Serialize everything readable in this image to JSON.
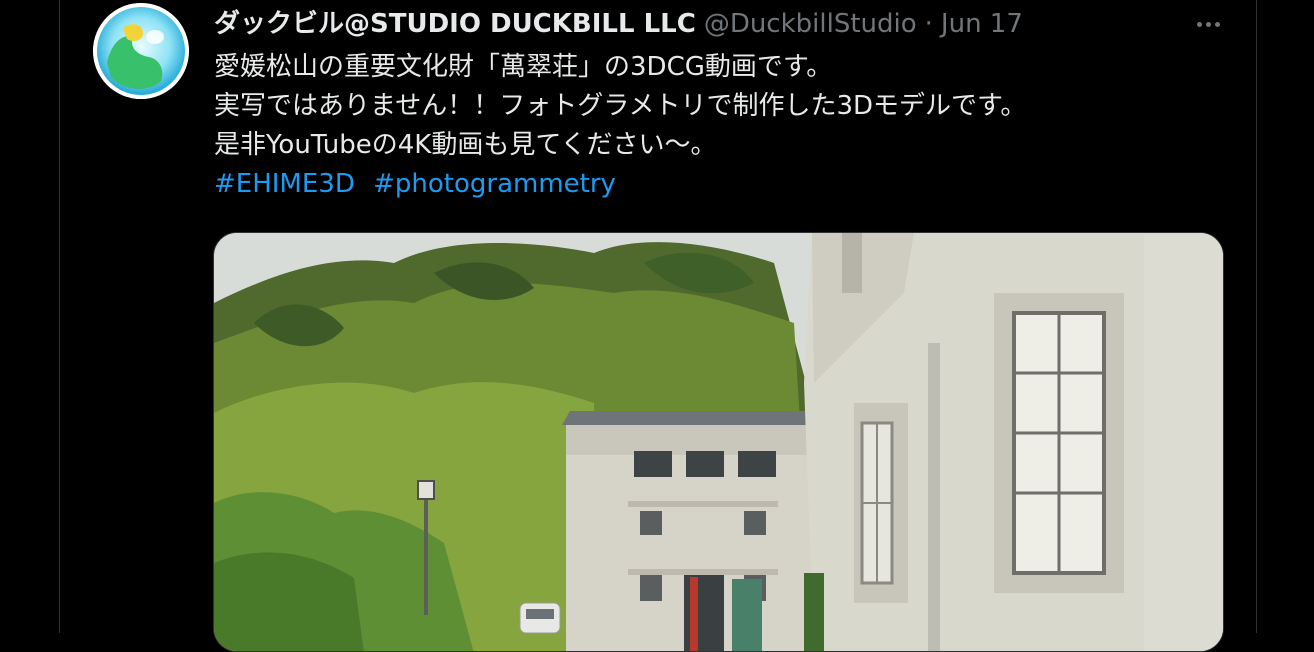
{
  "tweet": {
    "display_name": "ダックビル@STUDIO DUCKBILL LLC",
    "handle": "@DuckbillStudio",
    "separator": "·",
    "date": "Jun 17",
    "lines": [
      "愛媛松山の重要文化財「萬翠荘」の3DCG動画です。",
      "実写ではありません！！フォトグラメトリで制作した3Dモデルです。",
      "是非YouTubeの4K動画も見てください〜。"
    ],
    "hashtags": [
      "#EHIME3D",
      "#photogrammetry"
    ]
  },
  "icons": {
    "avatar": "duckbill-logo",
    "more": "more-icon"
  },
  "colors": {
    "background": "#000000",
    "text": "#e7e9ea",
    "secondary": "#71767b",
    "accent": "#1d9bf0"
  }
}
